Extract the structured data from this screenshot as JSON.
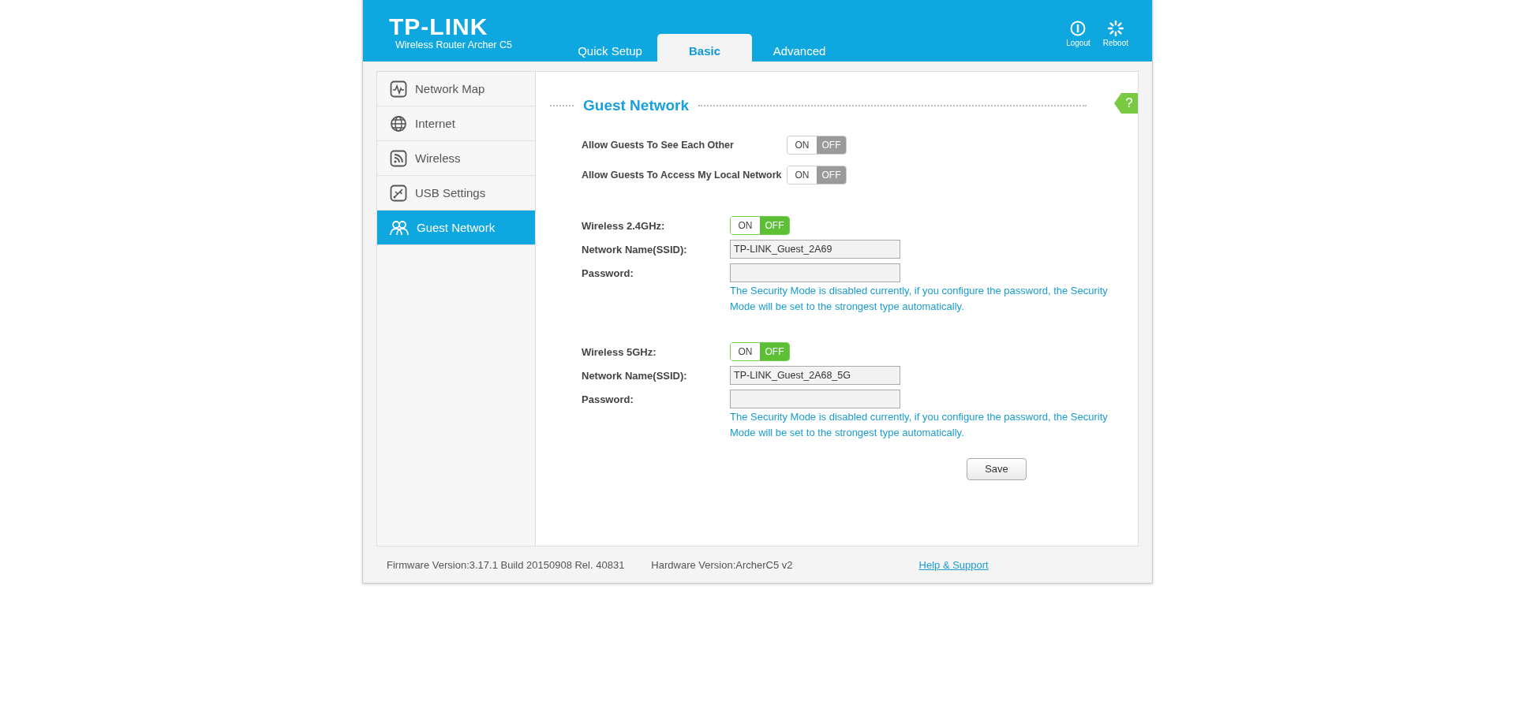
{
  "header": {
    "logo": "TP-LINK",
    "model": "Wireless Router Archer C5",
    "tabs": [
      {
        "label": "Quick Setup",
        "selected": false
      },
      {
        "label": "Basic",
        "selected": true
      },
      {
        "label": "Advanced",
        "selected": false
      }
    ],
    "actions": [
      {
        "kind": "logout",
        "label": "Logout"
      },
      {
        "kind": "reboot",
        "label": "Reboot"
      }
    ]
  },
  "sidebar": {
    "items": [
      {
        "kind": "map",
        "label": "Network Map",
        "selected": false
      },
      {
        "kind": "globe",
        "label": "Internet",
        "selected": false
      },
      {
        "kind": "wireless",
        "label": "Wireless",
        "selected": false
      },
      {
        "kind": "usb",
        "label": "USB Settings",
        "selected": false
      },
      {
        "kind": "guest",
        "label": "Guest Network",
        "selected": true
      }
    ]
  },
  "content": {
    "title": "Guest Network",
    "help_badge": "?",
    "options": [
      {
        "label": "Allow Guests To See Each Other",
        "on_label": "ON",
        "off_label": "OFF",
        "on": false,
        "disabled": true
      },
      {
        "label": "Allow Guests To Access My Local Network",
        "on_label": "ON",
        "off_label": "OFF",
        "on": false,
        "disabled": true
      }
    ],
    "bands": [
      {
        "label": "Wireless 2.4GHz:",
        "on_label": "ON",
        "off_label": "OFF",
        "on": false,
        "disabled": false,
        "ssid_label": "Network Name(SSID):",
        "ssid": "TP-LINK_Guest_2A69",
        "password_label": "Password:",
        "note": "The Security Mode is disabled currently, if you configure the password, the Security Mode will be set to the strongest type automatically."
      },
      {
        "label": "Wireless 5GHz:",
        "on_label": "ON",
        "off_label": "OFF",
        "on": false,
        "disabled": false,
        "ssid_label": "Network Name(SSID):",
        "ssid": "TP-LINK_Guest_2A68_5G",
        "password_label": "Password:",
        "note": "The Security Mode is disabled currently, if you configure the password, the Security Mode will be set to the strongest type automatically."
      }
    ],
    "save_button": "Save"
  },
  "footer": {
    "firmware": "Firmware Version:3.17.1 Build 20150908 Rel. 40831",
    "hardware": "Hardware Version:ArcherC5 v2",
    "help_link": "Help & Support"
  }
}
